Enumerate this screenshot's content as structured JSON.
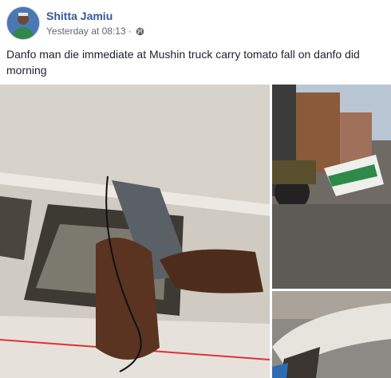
{
  "post": {
    "author": "Shitta Jamiu",
    "timestamp": "Yesterday at 08:13",
    "separator": "·",
    "privacy_icon": "globe-icon",
    "text": "Danfo man die immediate at Mushin truck carry tomato fall on danfo did morning"
  },
  "colors": {
    "author_link": "#385898",
    "meta_gray": "#616770",
    "text": "#1d2129"
  },
  "photos": [
    {
      "subject": "hands-holding-phone-inside-bus"
    },
    {
      "subject": "forklift-and-overturned-bus-on-street"
    },
    {
      "subject": "crushed-bus-roof"
    }
  ]
}
